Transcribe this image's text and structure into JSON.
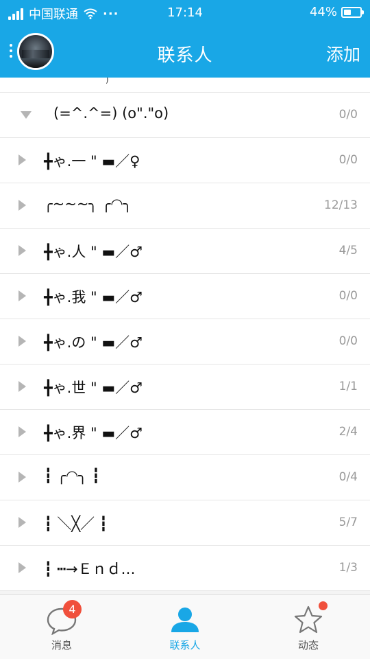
{
  "status_bar": {
    "carrier": "中国联通",
    "dots": "···",
    "time": "17:14",
    "battery_text": "44%",
    "battery_level": 0.44
  },
  "header": {
    "title": "联系人",
    "add_label": "添加"
  },
  "groups": [
    {
      "name": "(=^.^=) (o\".\"o)",
      "count": "0/0",
      "expanded": true
    },
    {
      "name": "╋ゃ.一 \" ▬／♀",
      "count": "0/0",
      "expanded": false
    },
    {
      "name": "╭~~~╮    ╭◠╮",
      "count": "12/13",
      "expanded": false
    },
    {
      "name": "╋ゃ.人 \" ▬／♂",
      "count": "4/5",
      "expanded": false
    },
    {
      "name": "╋ゃ.我 \" ▬／♂",
      "count": "0/0",
      "expanded": false
    },
    {
      "name": "╋ゃ.の \" ▬／♂",
      "count": "0/0",
      "expanded": false
    },
    {
      "name": "╋ゃ.世 \" ▬／♂",
      "count": "1/1",
      "expanded": false
    },
    {
      "name": "╋ゃ.界 \" ▬／♂",
      "count": "2/4",
      "expanded": false
    },
    {
      "name": "┇ ╭◠╮ ┇",
      "count": "0/4",
      "expanded": false
    },
    {
      "name": "┇ ＼╳／ ┇",
      "count": "5/7",
      "expanded": false
    },
    {
      "name": "┇ ┅→Ｅｎｄ…",
      "count": "1/3",
      "expanded": false
    }
  ],
  "tabs": [
    {
      "label": "消息",
      "badge": "4",
      "icon": "chat-bubble-icon"
    },
    {
      "label": "联系人",
      "icon": "contacts-person-icon",
      "active": true
    },
    {
      "label": "动态",
      "icon": "star-icon"
    }
  ],
  "colors": {
    "accent": "#19a7e6",
    "badge": "#f0503c",
    "count_text": "#999999"
  }
}
